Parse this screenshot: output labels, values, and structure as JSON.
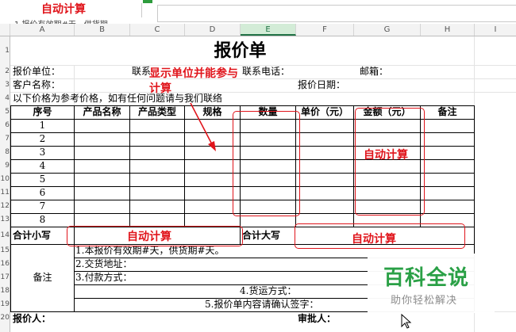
{
  "toolbar": {
    "top_annotation": "自动计算",
    "clipped_text": "1.报价有效期#天，供货期"
  },
  "columns": [
    "A",
    "B",
    "C",
    "D",
    "E",
    "F",
    "G",
    "H",
    "I"
  ],
  "selected_column": "E",
  "rows": [
    "1",
    "2",
    "3",
    "4",
    "5",
    "6",
    "7",
    "8",
    "9",
    "10",
    "11",
    "12",
    "13",
    "14",
    "15",
    "16",
    "17",
    "18",
    "19",
    "20"
  ],
  "sheet": {
    "title": "报价单",
    "quote_unit_label": "报价单位：",
    "contact_label": "联系",
    "phone_label": "联系电话：",
    "email_label": "邮箱：",
    "customer_label": "客户名称：",
    "date_label": "报价日期：",
    "note_line": "以下价格为参考价格，如有任何问题请与我们联络",
    "headers": [
      "序号",
      "产品名称",
      "产品类型",
      "规格",
      "数量",
      "单价（元）",
      "金额（元）",
      "备注"
    ],
    "item_numbers": [
      "1",
      "2",
      "3",
      "4",
      "5",
      "6",
      "7",
      "8"
    ],
    "total_lower_label": "合计小写",
    "total_upper_label": "合计大写",
    "remarks_label": "备注",
    "remark_lines": [
      "1.本报价有效期#天，供货期#天。",
      "2.交货地址：",
      "3.付款方式：",
      "4.货运方式：",
      "5.报价单内容请确认签字："
    ],
    "quoter_label": "报价人：",
    "approver_label": "审批人："
  },
  "annotations": {
    "show_unit_note": "显示单位并能参与计算",
    "auto_calc_amount": "自动计算",
    "auto_calc_lower": "自动计算",
    "auto_calc_upper": "自动计算"
  },
  "watermark": {
    "title": "百科全说",
    "subtitle": "助你轻松解决"
  },
  "colors": {
    "annotation_red": "#e0141b",
    "selected_column": "#217346",
    "watermark_green": "#2aa046"
  }
}
